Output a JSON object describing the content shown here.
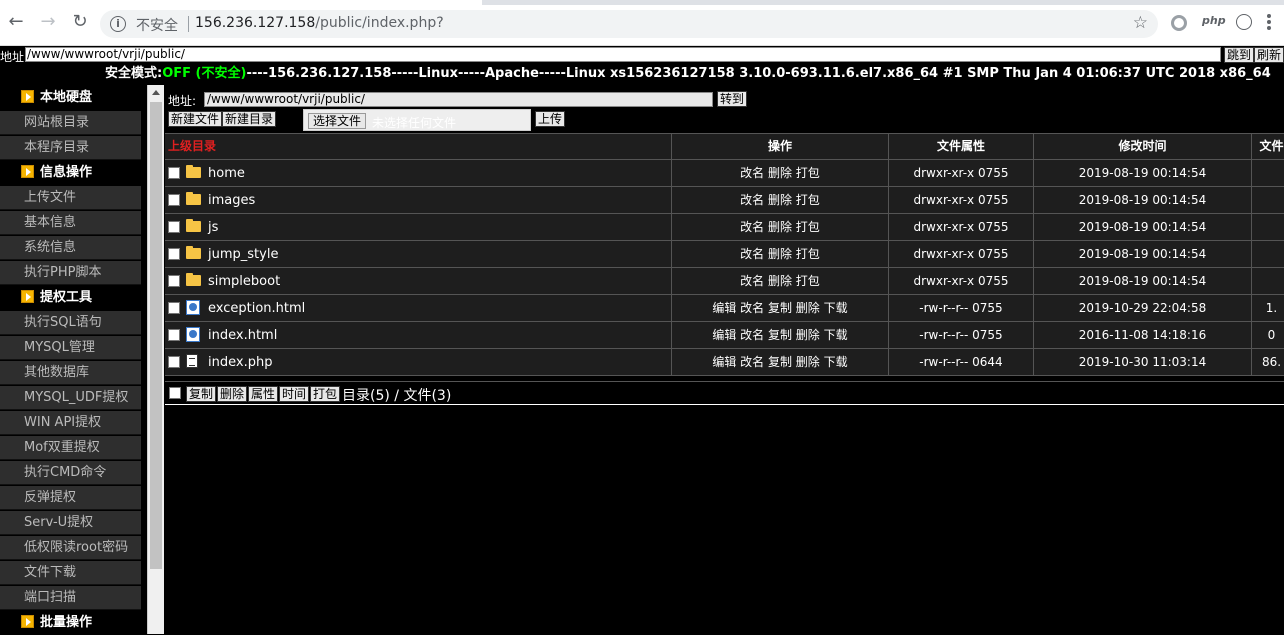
{
  "browser": {
    "security_label": "不安全",
    "url_host": "156.236.127.158",
    "url_path": "/public/index.php?",
    "ext_php_label": "php"
  },
  "address_bar": {
    "label": "地址:",
    "value": "/www/wwwroot/vrji/public/",
    "go_label": "跳到",
    "refresh_label": "刷新"
  },
  "info_bar": {
    "safe_mode_label": "安全模式:",
    "safe_mode_value": "OFF (不安全)",
    "rest": "----156.236.127.158-----Linux-----Apache-----Linux xs156236127158 3.10.0-693.11.6.el7.x86_64 #1 SMP Thu Jan 4 01:06:37 UTC 2018 x86_64"
  },
  "sidebar": {
    "sections": [
      {
        "title": "本地硬盘",
        "items": [
          "网站根目录",
          "本程序目录"
        ]
      },
      {
        "title": "信息操作",
        "items": [
          "上传文件",
          "基本信息",
          "系统信息",
          "执行PHP脚本"
        ]
      },
      {
        "title": "提权工具",
        "items": [
          "执行SQL语句",
          "MYSQL管理",
          "其他数据库",
          "MYSQL_UDF提权",
          "WIN API提权",
          "Mof双重提权",
          "执行CMD命令",
          "反弹提权",
          "Serv-U提权",
          "低权限读root密码",
          "文件下载",
          "端口扫描"
        ]
      },
      {
        "title": "批量操作",
        "items": []
      }
    ]
  },
  "main": {
    "path_label": "地址:",
    "path_value": "/www/wwwroot/vrji/public/",
    "path_go_label": "转到",
    "new_file_label": "新建文件",
    "new_dir_label": "新建目录",
    "choose_file_label": "选择文件",
    "no_file_label": "未选择任何文件",
    "upload_label": "上传",
    "headers": {
      "parent": "上级目录",
      "ops": "操作",
      "attr": "文件属性",
      "time": "修改时间",
      "size": "文件"
    },
    "rows": [
      {
        "type": "folder",
        "name": "home",
        "ops": "改名 删除 打包",
        "attr": "drwxr-xr-x 0755",
        "time": "2019-08-19 00:14:54",
        "size": ""
      },
      {
        "type": "folder",
        "name": "images",
        "ops": "改名 删除 打包",
        "attr": "drwxr-xr-x 0755",
        "time": "2019-08-19 00:14:54",
        "size": ""
      },
      {
        "type": "folder",
        "name": "js",
        "ops": "改名 删除 打包",
        "attr": "drwxr-xr-x 0755",
        "time": "2019-08-19 00:14:54",
        "size": ""
      },
      {
        "type": "folder",
        "name": "jump_style",
        "ops": "改名 删除 打包",
        "attr": "drwxr-xr-x 0755",
        "time": "2019-08-19 00:14:54",
        "size": ""
      },
      {
        "type": "folder",
        "name": "simpleboot",
        "ops": "改名 删除 打包",
        "attr": "drwxr-xr-x 0755",
        "time": "2019-08-19 00:14:54",
        "size": ""
      },
      {
        "type": "html",
        "name": "exception.html",
        "ops": "编辑 改名 复制 删除 下载",
        "attr": "-rw-r--r-- 0755",
        "time": "2019-10-29 22:04:58",
        "size": "1."
      },
      {
        "type": "html",
        "name": "index.html",
        "ops": "编辑 改名 复制 删除 下载",
        "attr": "-rw-r--r-- 0755",
        "time": "2016-11-08 14:18:16",
        "size": "0"
      },
      {
        "type": "php",
        "name": "index.php",
        "ops": "编辑 改名 复制 删除 下载",
        "attr": "-rw-r--r-- 0644",
        "time": "2019-10-30 11:03:14",
        "size": "86."
      }
    ],
    "bottom_buttons": [
      "复制",
      "删除",
      "属性",
      "时间",
      "打包"
    ],
    "summary": "目录(5) / 文件(3)"
  }
}
